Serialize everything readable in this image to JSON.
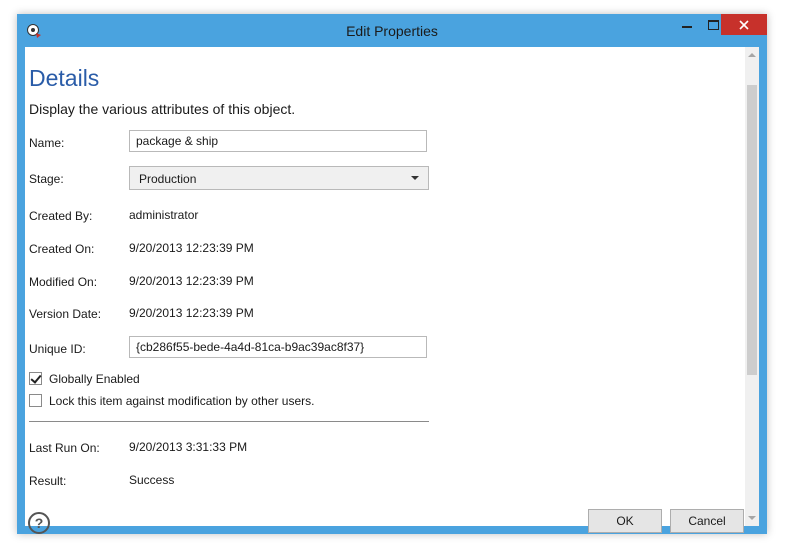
{
  "window": {
    "title": "Edit Properties"
  },
  "header": {
    "heading": "Details",
    "subtitle": "Display the various attributes of this object."
  },
  "fields": {
    "name_label": "Name:",
    "name_value": "package & ship",
    "stage_label": "Stage:",
    "stage_value": "Production",
    "created_by_label": "Created By:",
    "created_by_value": "administrator",
    "created_on_label": "Created On:",
    "created_on_value": "9/20/2013 12:23:39 PM",
    "modified_on_label": "Modified On:",
    "modified_on_value": "9/20/2013 12:23:39 PM",
    "version_date_label": "Version Date:",
    "version_date_value": "9/20/2013 12:23:39 PM",
    "unique_id_label": "Unique ID:",
    "unique_id_value": "{cb286f55-bede-4a4d-81ca-b9ac39ac8f37}"
  },
  "checkboxes": {
    "globally_enabled_label": "Globally Enabled",
    "globally_enabled_checked": true,
    "lock_label": "Lock this item against modification by other users.",
    "lock_checked": false
  },
  "run_info": {
    "last_run_label": "Last Run On:",
    "last_run_value": "9/20/2013 3:31:33 PM",
    "result_label": "Result:",
    "result_value": "Success"
  },
  "buttons": {
    "help": "?",
    "ok": "OK",
    "cancel": "Cancel"
  },
  "colors": {
    "titlebar": "#4aa3df",
    "close_button": "#c7312b",
    "heading": "#2a5ca8"
  },
  "icons": {
    "app": "app-gear-icon",
    "minimize": "minimize-icon",
    "maximize": "maximize-icon",
    "close": "close-icon",
    "help": "help-icon",
    "dropdown": "chevron-down-icon"
  }
}
